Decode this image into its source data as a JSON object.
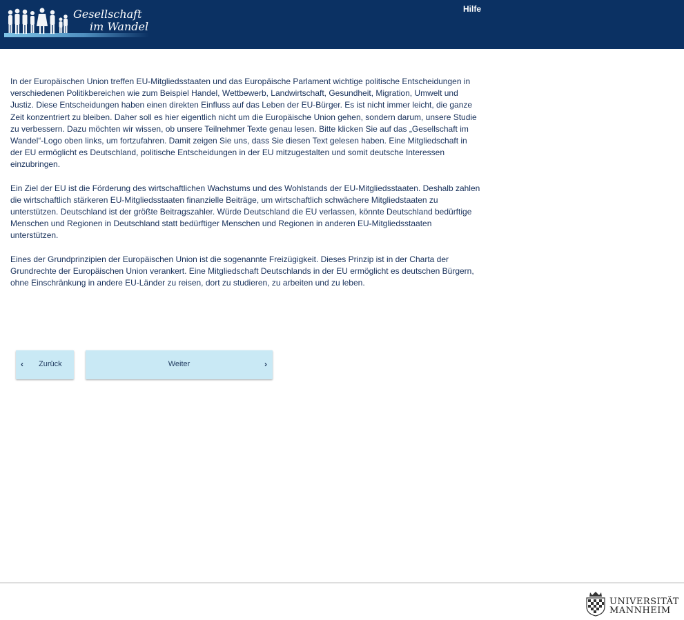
{
  "header": {
    "logo_line1": "Gesellschaft",
    "logo_line2": "im Wandel",
    "help_label": "Hilfe",
    "background_color": "#0b3163"
  },
  "content": {
    "paragraphs": [
      "In der Europäischen Union treffen EU-Mitgliedsstaaten und das Europäische Parlament wichtige politische Entscheidungen in verschiedenen Politikbereichen wie zum Beispiel Handel, Wettbewerb, Landwirtschaft, Gesundheit, Migration, Umwelt und Justiz. Diese Entscheidungen haben einen direkten Einfluss auf das Leben der EU-Bürger. Es ist nicht immer leicht, die ganze Zeit konzentriert zu bleiben. Daher soll es hier eigentlich nicht um die Europäische Union gehen, sondern darum, unsere Studie zu verbessern. Dazu möchten wir wissen, ob unsere Teilnehmer Texte genau lesen. Bitte klicken Sie auf das „Gesellschaft im Wandel“-Logo oben links, um fortzufahren. Damit zeigen Sie uns, dass Sie diesen Text gelesen haben. Eine Mitgliedschaft in der EU ermöglicht es Deutschland, politische Entscheidungen in der EU mitzugestalten und somit deutsche Interessen einzubringen.",
      "Ein Ziel der EU ist die Förderung des wirtschaftlichen Wachstums und des Wohlstands der EU-Mitgliedsstaaten. Deshalb zahlen die wirtschaftlich stärkeren EU-Mitgliedsstaaten finanzielle Beiträge, um wirtschaftlich schwächere Mitgliedstaaten zu unterstützen. Deutschland ist der größte Beitragszahler. Würde Deutschland die EU verlassen, könnte Deutschland bedürftige Menschen und Regionen in Deutschland statt bedürftiger Menschen und Regionen in anderen EU-Mitgliedsstaaten unterstützen.",
      "Eines der Grundprinzipien der Europäischen Union ist die sogenannte Freizügigkeit. Dieses Prinzip ist in der Charta der Grundrechte der Europäischen Union verankert. Eine Mitgliedschaft Deutschlands in der EU ermöglicht es deutschen Bürgern, ohne Einschränkung in andere EU-Länder zu reisen, dort zu studieren, zu arbeiten und zu leben."
    ]
  },
  "navigation": {
    "back_label": "Zurück",
    "next_label": "Weiter",
    "back_icon": "chevron-left-icon",
    "next_icon": "chevron-right-icon",
    "button_color": "#c9e9f5"
  },
  "footer": {
    "university_line1": "UNIVERSITÄT",
    "university_line2": "MANNHEIM",
    "crest_icon": "university-crest-icon"
  }
}
